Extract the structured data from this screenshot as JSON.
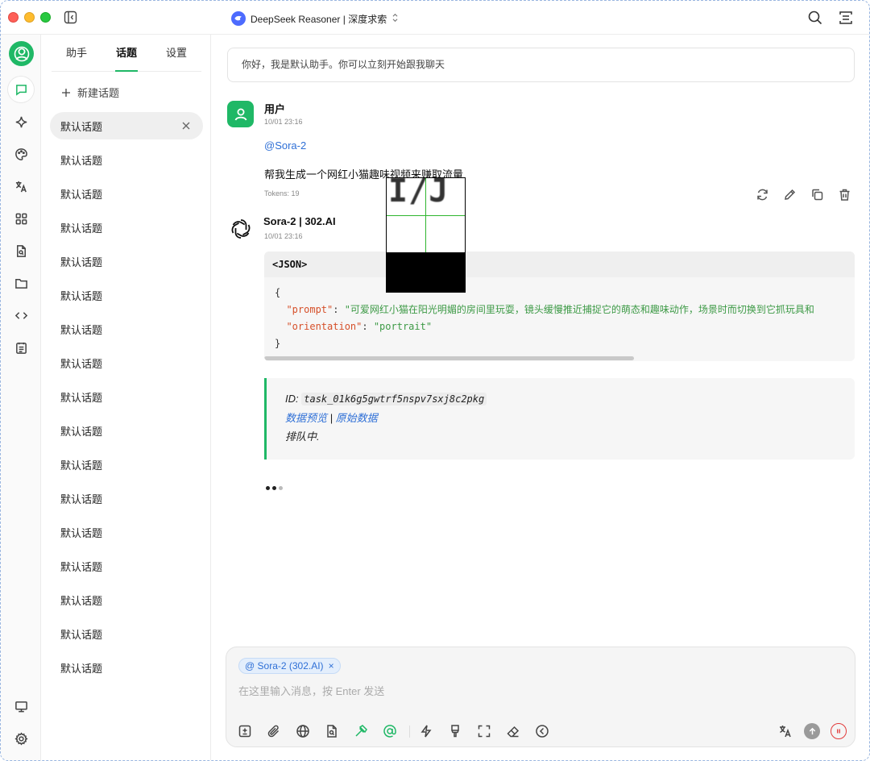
{
  "titlebar": {
    "model_name": "DeepSeek Reasoner | 深度求索"
  },
  "sidebar_tabs": [
    "助手",
    "话题",
    "设置"
  ],
  "topics": {
    "new_topic_label": "新建话题",
    "items": [
      "默认话题",
      "默认话题",
      "默认话题",
      "默认话题",
      "默认话题",
      "默认话题",
      "默认话题",
      "默认话题",
      "默认话题",
      "默认话题",
      "默认话题",
      "默认话题",
      "默认话题",
      "默认话题",
      "默认话题",
      "默认话题",
      "默认话题"
    ]
  },
  "chat": {
    "greeting": "你好，我是默认助手。你可以立刻开始跟我聊天",
    "user_message": {
      "author": "用户",
      "time": "10/01 23:16",
      "mention": "@Sora-2",
      "text": "帮我生成一个网红小猫趣味视频来赚取流量",
      "tokens": "Tokens: 19"
    },
    "assistant_message": {
      "author": "Sora-2 | 302.AI",
      "time": "10/01 23:16",
      "code_header": "<JSON>",
      "code_open": "{",
      "code_close": "}",
      "prompt_key": "\"prompt\"",
      "prompt_value": "\"可爱网红小猫在阳光明媚的房间里玩耍，镜头缓慢推近捕捉它的萌态和趣味动作，场景时而切换到它抓玩具和",
      "orientation_key": "\"orientation\"",
      "orientation_value": "\"portrait\"",
      "task_id_label": "ID:",
      "task_id": "task_01k6g5gwtrf5nspv7sxj8c2pkg",
      "preview_link": "数据预览",
      "separator": "|",
      "raw_link": "原始数据",
      "status": "排队中."
    }
  },
  "inspector_glyphs": "I/J",
  "composer": {
    "chip_label": "@ Sora-2 (302.AI)",
    "chip_close": "×",
    "placeholder": "在这里输入消息，按 Enter 发送"
  },
  "colors": {
    "accent": "#1fb866",
    "link": "#2e6fd6",
    "stop": "#e23b3b"
  }
}
